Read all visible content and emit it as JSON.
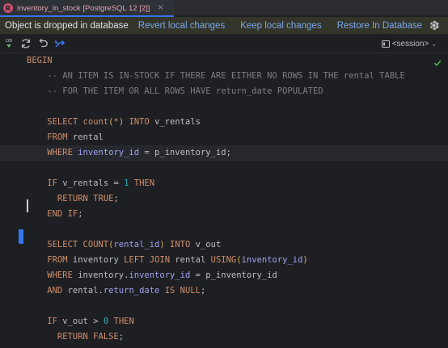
{
  "tab": {
    "icon_letter": "R",
    "title": "inventory_in_stock [PostgreSQL 12 [2]]",
    "close_glyph": "×",
    "accent_color": "#c94f6d"
  },
  "notification": {
    "message": "Object is dropped in database",
    "actions": {
      "revert": "Revert local changes",
      "keep": "Keep local changes",
      "restore": "Restore In Database"
    },
    "settings_icon": "gear-icon"
  },
  "toolbar": {
    "db_label": "DB",
    "session_label": "<session>",
    "icons": [
      "database-run-icon",
      "refresh-icon",
      "revert-icon",
      "transaction-icon",
      "session-icon",
      "chevron-down-icon"
    ]
  },
  "editor": {
    "status_icon": "check-icon",
    "status_color": "#4caf50",
    "lines": [
      {
        "tokens": [
          {
            "t": "BEGIN",
            "c": "kw"
          }
        ]
      },
      {
        "tokens": [
          {
            "t": "    -- AN ITEM IS IN-STOCK IF THERE ARE EITHER NO ROWS IN THE rental TABLE",
            "c": "cmt"
          }
        ]
      },
      {
        "tokens": [
          {
            "t": "    -- FOR THE ITEM OR ALL ROWS HAVE return_date POPULATED",
            "c": "cmt"
          }
        ]
      },
      {
        "tokens": []
      },
      {
        "tokens": [
          {
            "t": "    SELECT ",
            "c": "kw"
          },
          {
            "t": "count",
            "c": "kw"
          },
          {
            "t": "(",
            "c": "paren"
          },
          {
            "t": "*",
            "c": "kw"
          },
          {
            "t": ")",
            "c": "paren"
          },
          {
            "t": " INTO ",
            "c": "kw"
          },
          {
            "t": "v_rentals",
            "c": "id"
          }
        ]
      },
      {
        "tokens": [
          {
            "t": "    FROM ",
            "c": "kw"
          },
          {
            "t": "rental",
            "c": "id"
          }
        ]
      },
      {
        "tokens": [
          {
            "t": "    WHERE ",
            "c": "kw"
          },
          {
            "t": "inventory_id",
            "c": "col"
          },
          {
            "t": " = ",
            "c": "op"
          },
          {
            "t": "p_inventory_id",
            "c": "id"
          },
          {
            "t": ";",
            "c": "op"
          }
        ],
        "current": true
      },
      {
        "tokens": []
      },
      {
        "tokens": [
          {
            "t": "    IF ",
            "c": "kw"
          },
          {
            "t": "v_rentals",
            "c": "id"
          },
          {
            "t": " = ",
            "c": "op"
          },
          {
            "t": "1",
            "c": "num"
          },
          {
            "t": " THEN",
            "c": "kw"
          }
        ]
      },
      {
        "tokens": [
          {
            "t": "      RETURN TRUE",
            "c": "kw"
          },
          {
            "t": ";",
            "c": "op"
          }
        ]
      },
      {
        "tokens": [
          {
            "t": "    END IF",
            "c": "kw"
          },
          {
            "t": ";",
            "c": "op"
          }
        ]
      },
      {
        "tokens": []
      },
      {
        "tokens": [
          {
            "t": "    SELECT ",
            "c": "kw"
          },
          {
            "t": "COUNT",
            "c": "kw"
          },
          {
            "t": "(",
            "c": "paren"
          },
          {
            "t": "rental_id",
            "c": "col"
          },
          {
            "t": ")",
            "c": "paren"
          },
          {
            "t": " INTO ",
            "c": "kw"
          },
          {
            "t": "v_out",
            "c": "id"
          }
        ]
      },
      {
        "tokens": [
          {
            "t": "    FROM ",
            "c": "kw"
          },
          {
            "t": "inventory",
            "c": "id"
          },
          {
            "t": " LEFT JOIN ",
            "c": "kw"
          },
          {
            "t": "rental",
            "c": "id"
          },
          {
            "t": " USING",
            "c": "kw"
          },
          {
            "t": "(",
            "c": "paren"
          },
          {
            "t": "inventory_id",
            "c": "col"
          },
          {
            "t": ")",
            "c": "paren"
          }
        ]
      },
      {
        "tokens": [
          {
            "t": "    WHERE ",
            "c": "kw"
          },
          {
            "t": "inventory",
            "c": "id"
          },
          {
            "t": ".",
            "c": "op"
          },
          {
            "t": "inventory_id",
            "c": "col"
          },
          {
            "t": " = ",
            "c": "op"
          },
          {
            "t": "p_inventory_id",
            "c": "id"
          }
        ]
      },
      {
        "tokens": [
          {
            "t": "    AND ",
            "c": "kw"
          },
          {
            "t": "rental",
            "c": "id"
          },
          {
            "t": ".",
            "c": "op"
          },
          {
            "t": "return_date",
            "c": "col"
          },
          {
            "t": " IS NULL",
            "c": "kw"
          },
          {
            "t": ";",
            "c": "op"
          }
        ]
      },
      {
        "tokens": []
      },
      {
        "tokens": [
          {
            "t": "    IF ",
            "c": "kw"
          },
          {
            "t": "v_out",
            "c": "id"
          },
          {
            "t": " > ",
            "c": "op"
          },
          {
            "t": "0",
            "c": "num"
          },
          {
            "t": " THEN",
            "c": "kw"
          }
        ]
      },
      {
        "tokens": [
          {
            "t": "      RETURN FALSE",
            "c": "kw"
          },
          {
            "t": ";",
            "c": "op"
          }
        ]
      }
    ]
  }
}
